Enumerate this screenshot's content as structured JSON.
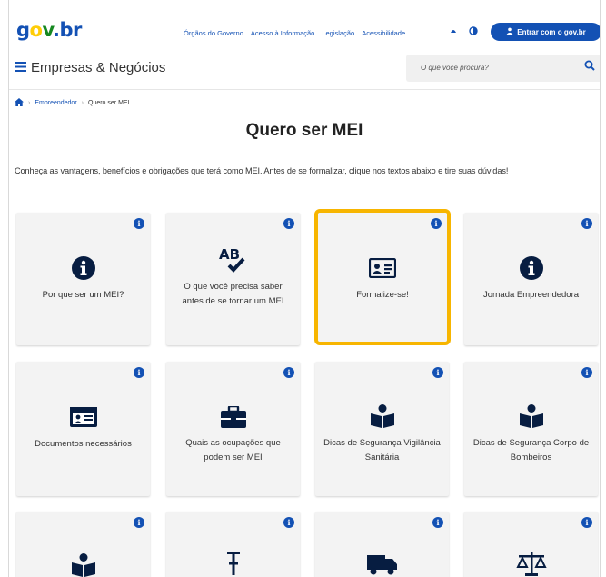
{
  "header": {
    "logo_parts": {
      "g": "g",
      "o": "o",
      "v": "v",
      "b": "br"
    },
    "links": [
      "Órgãos do Governo",
      "Acesso à Informação",
      "Legislação",
      "Acessibilidade"
    ],
    "icons": [
      "contrast-icon",
      "theme-icon"
    ],
    "login_label": "Entrar com o gov.br"
  },
  "subheader": {
    "menu_title": "Empresas & Negócios",
    "search_placeholder": "O que você procura?"
  },
  "breadcrumb": {
    "items": [
      "Empreendedor",
      "Quero ser MEI"
    ]
  },
  "page": {
    "title": "Quero ser MEI",
    "intro": "Conheça as vantagens, benefícios e obrigações que terá como MEI. Antes de se formalizar, clique nos textos abaixo e tire suas dúvidas!"
  },
  "cards": [
    {
      "label": "Por que ser um MEI?",
      "icon": "info-circle-icon"
    },
    {
      "label": "O que você precisa saber antes de se tornar um MEI",
      "icon": "spellcheck-icon"
    },
    {
      "label": "Formalize-se!",
      "icon": "id-card-icon",
      "highlighted": true
    },
    {
      "label": "Jornada Empreendedora",
      "icon": "info-circle-icon"
    },
    {
      "label": "Documentos necessários",
      "icon": "id-card-icon"
    },
    {
      "label": "Quais as ocupações que podem ser MEI",
      "icon": "briefcase-icon"
    },
    {
      "label": "Dicas de Segurança Vigilância Sanitária",
      "icon": "book-reader-icon"
    },
    {
      "label": "Dicas de Segurança Corpo de Bombeiros",
      "icon": "book-reader-icon"
    },
    {
      "label": "",
      "icon": "book-reader-icon"
    },
    {
      "label": "",
      "icon": "text-cursor-icon"
    },
    {
      "label": "",
      "icon": "truck-icon"
    },
    {
      "label": "",
      "icon": "balance-scale-icon"
    }
  ],
  "colors": {
    "brand_blue": "#1351b4",
    "icon_navy": "#071d41",
    "highlight": "#f7b500",
    "card_bg": "#f3f3f3"
  }
}
